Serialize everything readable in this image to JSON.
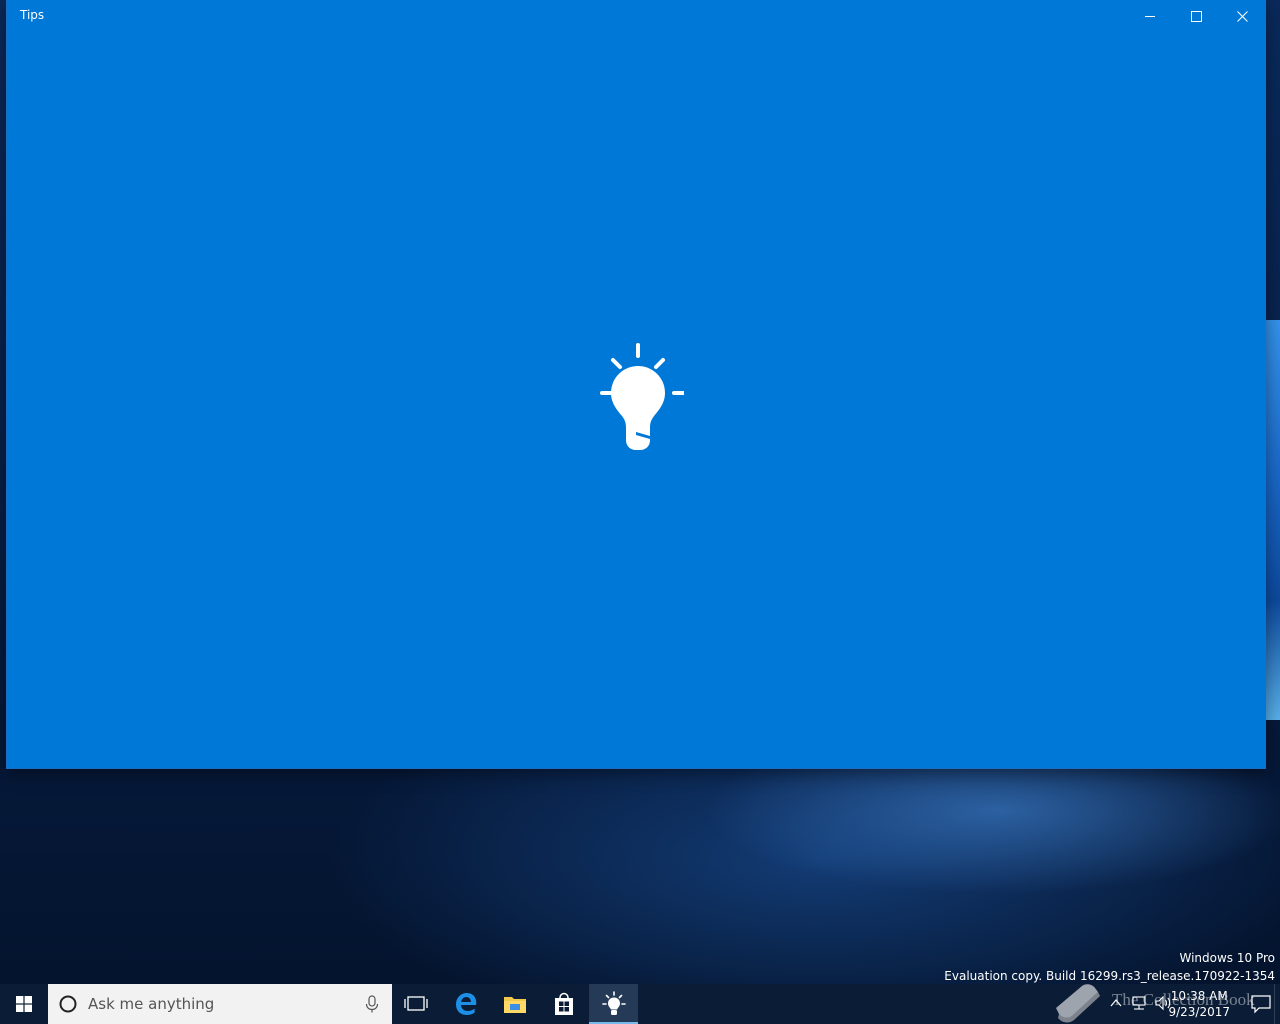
{
  "window": {
    "title": "Tips",
    "minimize_icon": "minimize-icon",
    "maximize_icon": "maximize-icon",
    "close_icon": "close-icon",
    "splash_icon": "lightbulb-icon",
    "background_color": "#0078d7"
  },
  "watermark": {
    "edition": "Windows 10 Pro",
    "build": "Evaluation copy. Build 16299.rs3_release.170922-1354"
  },
  "taskbar": {
    "search_placeholder": "Ask me anything",
    "apps": [
      {
        "name": "Task View",
        "icon": "task-view-icon"
      },
      {
        "name": "Microsoft Edge",
        "icon": "edge-icon"
      },
      {
        "name": "File Explorer",
        "icon": "folder-icon"
      },
      {
        "name": "Store",
        "icon": "store-icon"
      },
      {
        "name": "Tips",
        "icon": "lightbulb-icon",
        "active": true
      }
    ],
    "tray_overlay_text": "The Collection Book",
    "clock": {
      "time": "10:38 AM",
      "date": "9/23/2017"
    }
  }
}
